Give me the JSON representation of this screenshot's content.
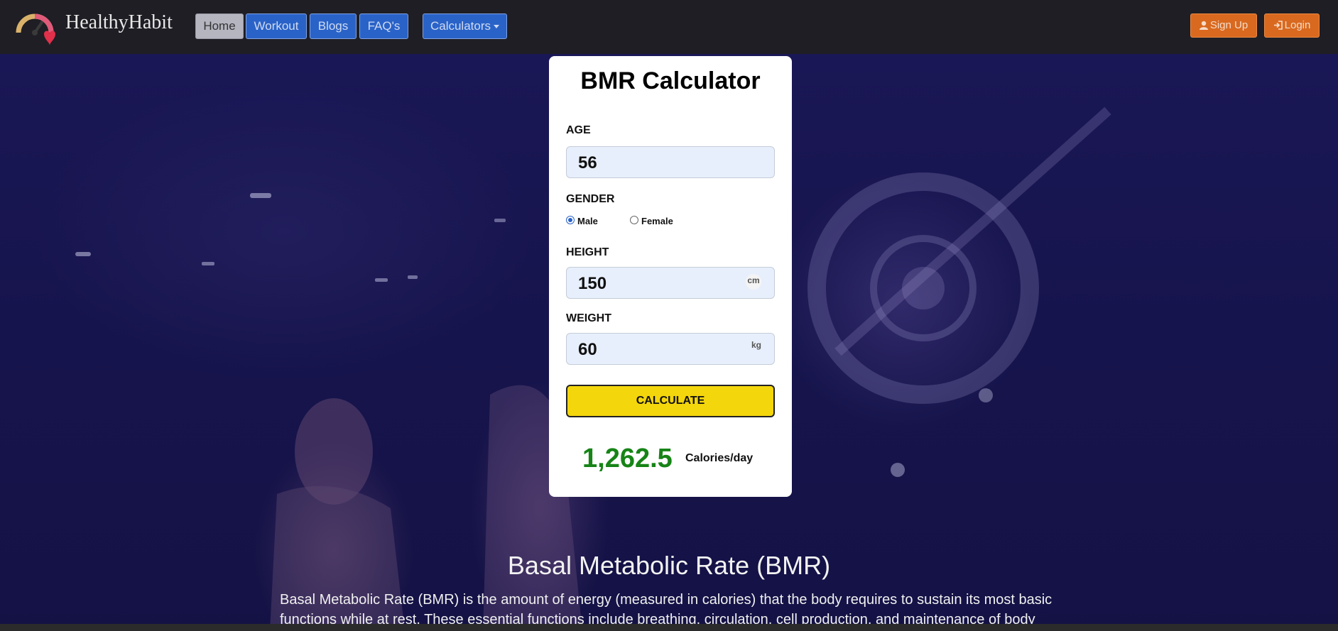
{
  "brand": {
    "name": "HealthyHabit",
    "logo_icon": "speedometer-heart-icon"
  },
  "nav": {
    "home": "Home",
    "workout": "Workout",
    "blogs": "Blogs",
    "faqs": "FAQ's",
    "calculators": "Calculators"
  },
  "auth": {
    "signup": "Sign Up",
    "signup_icon": "user-icon",
    "login": "Login",
    "login_icon": "sign-in-icon"
  },
  "calculator": {
    "title": "BMR Calculator",
    "age_label": "AGE",
    "age_value": "56",
    "gender_label": "GENDER",
    "gender_options": [
      "Male",
      "Female"
    ],
    "gender_selected": "Male",
    "height_label": "HEIGHT",
    "height_value": "150",
    "height_unit": "cm",
    "weight_label": "WEIGHT",
    "weight_value": "60",
    "weight_unit": "kg",
    "calculate_label": "CALCULATE",
    "result_value": "1,262.5",
    "result_unit": "Calories/day"
  },
  "article": {
    "title": "Basal Metabolic Rate (BMR)",
    "body": "Basal Metabolic Rate (BMR) is the amount of energy (measured in calories) that the body requires to sustain its most basic functions while at rest. These essential functions include breathing, circulation, cell production, and maintenance of body"
  },
  "colors": {
    "navbar": "#1e1e24",
    "nav_button": "#2a63c8",
    "auth_button": "#d9691f",
    "calculate_button": "#f4d60c",
    "result": "#168416",
    "background": "#15134a"
  }
}
